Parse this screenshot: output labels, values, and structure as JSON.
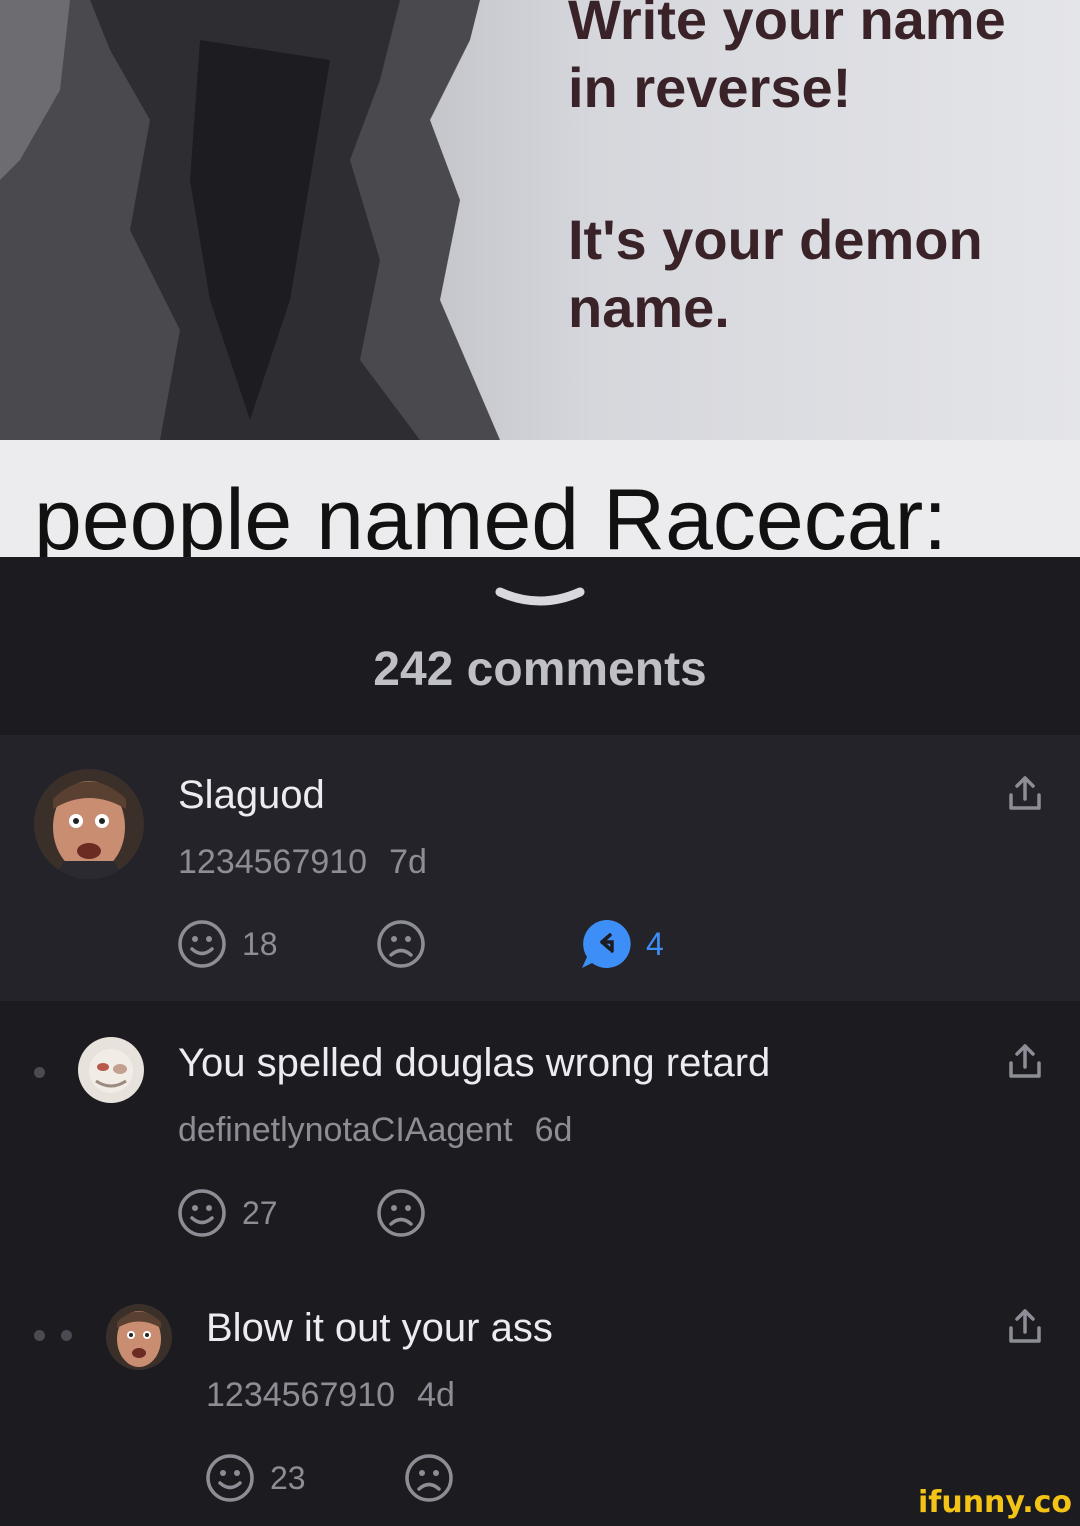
{
  "meme": {
    "top_text": "Write your name in reverse!",
    "middle_text": "It's your demon name.",
    "caption": "people named Racecar:"
  },
  "comments_header": {
    "count_label": "242 comments"
  },
  "comments": [
    {
      "text": "Slaguod",
      "author": "1234567910",
      "age": "7d",
      "smile_count": "18",
      "reply_count": "4"
    },
    {
      "text": "You spelled douglas wrong retard",
      "author": "definetlynotaCIAagent",
      "age": "6d",
      "smile_count": "27"
    },
    {
      "text": "Blow it out your ass",
      "author": "1234567910",
      "age": "4d",
      "smile_count": "23"
    }
  ],
  "icons": {
    "smile": "smile-icon",
    "frown": "frown-icon",
    "reply": "reply-bubble-icon",
    "share": "share-icon",
    "handle": "chevron-down-handle-icon"
  },
  "colors": {
    "background": "#1c1c20",
    "accent_blue": "#3e8ef7",
    "watermark": "#f3c316"
  },
  "watermark": "ifunny.co"
}
